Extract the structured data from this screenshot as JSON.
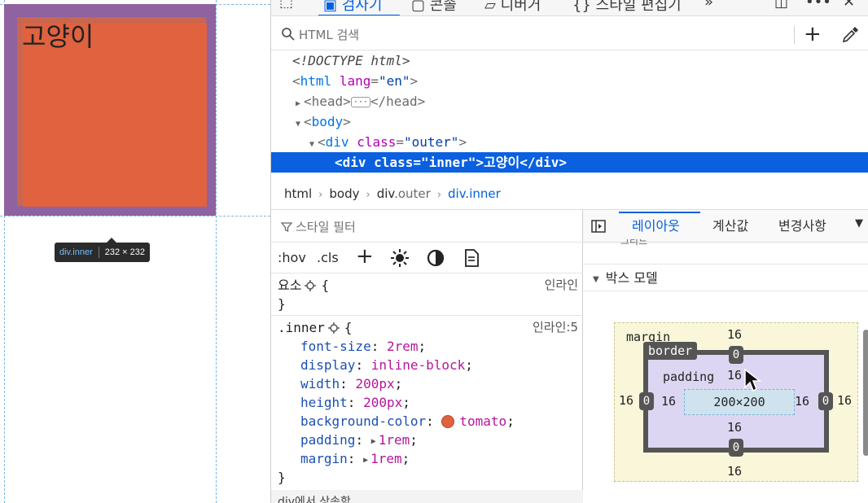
{
  "viewport": {
    "element_text": "고양이",
    "tooltip": {
      "tag": "div.inner",
      "size": "232 × 232"
    }
  },
  "toolbar": {
    "items": [
      "검사기",
      "콘솔",
      "디버거",
      "스타일 편집기"
    ],
    "overflow": "»"
  },
  "inspector": {
    "search_placeholder": "HTML 검색",
    "add_node_icon": "plus-icon",
    "picker_icon": "eyedropper-icon"
  },
  "markup": {
    "doctype": "<!DOCTYPE html>",
    "html_tag": "html",
    "html_attr_name": "lang",
    "html_attr_value": "\"en\"",
    "head_tag": "head",
    "body_tag": "body",
    "outer_tag": "div",
    "outer_attr_name": "class",
    "outer_attr_value": "\"outer\"",
    "selected_open": "<div class=\"inner\">",
    "selected_text": "고양이",
    "selected_close": "</div>"
  },
  "breadcrumb": {
    "items": [
      {
        "tag": "html",
        "cls": ""
      },
      {
        "tag": "body",
        "cls": ""
      },
      {
        "tag": "div",
        "cls": ".outer"
      },
      {
        "tag": "div.inner",
        "cls": ""
      }
    ]
  },
  "rules": {
    "filter_placeholder": "스타일 필터",
    "pseudo": {
      "hov": ":hov",
      "cls": ".cls"
    },
    "element_rule": {
      "selector": "요소",
      "open": "{",
      "close": "}",
      "source": "인라인"
    },
    "inner_rule": {
      "selector": ".inner",
      "open": "{",
      "close": "}",
      "source": "인라인:5",
      "declarations": [
        {
          "name": "font-size",
          "value": "2rem"
        },
        {
          "name": "display",
          "value": "inline-block"
        },
        {
          "name": "width",
          "value": "200px"
        },
        {
          "name": "height",
          "value": "200px"
        },
        {
          "name": "background-color",
          "value": "tomato"
        },
        {
          "name": "padding",
          "value": "1rem"
        },
        {
          "name": "margin",
          "value": "1rem"
        }
      ]
    },
    "inherited_label": "div에서 상속함"
  },
  "colors": {
    "tomato": "#e0623f",
    "selection": "#0a60df",
    "accent": "#0060df"
  },
  "layout": {
    "tabs": [
      "레이아웃",
      "계산값",
      "변경사항"
    ],
    "active_tab": "레이아웃",
    "partial_header": "그리드",
    "box_model_header": "박스 모델",
    "box_model": {
      "margin_label": "margin",
      "border_label": "border",
      "padding_label": "padding",
      "content": "200×200",
      "margin": {
        "top": "16",
        "right": "16",
        "bottom": "16",
        "left": "16"
      },
      "border": {
        "top": "0",
        "right": "0",
        "bottom": "0",
        "left": "0"
      },
      "padding": {
        "top": "16",
        "right": "16",
        "bottom": "16",
        "left": "16"
      }
    }
  }
}
